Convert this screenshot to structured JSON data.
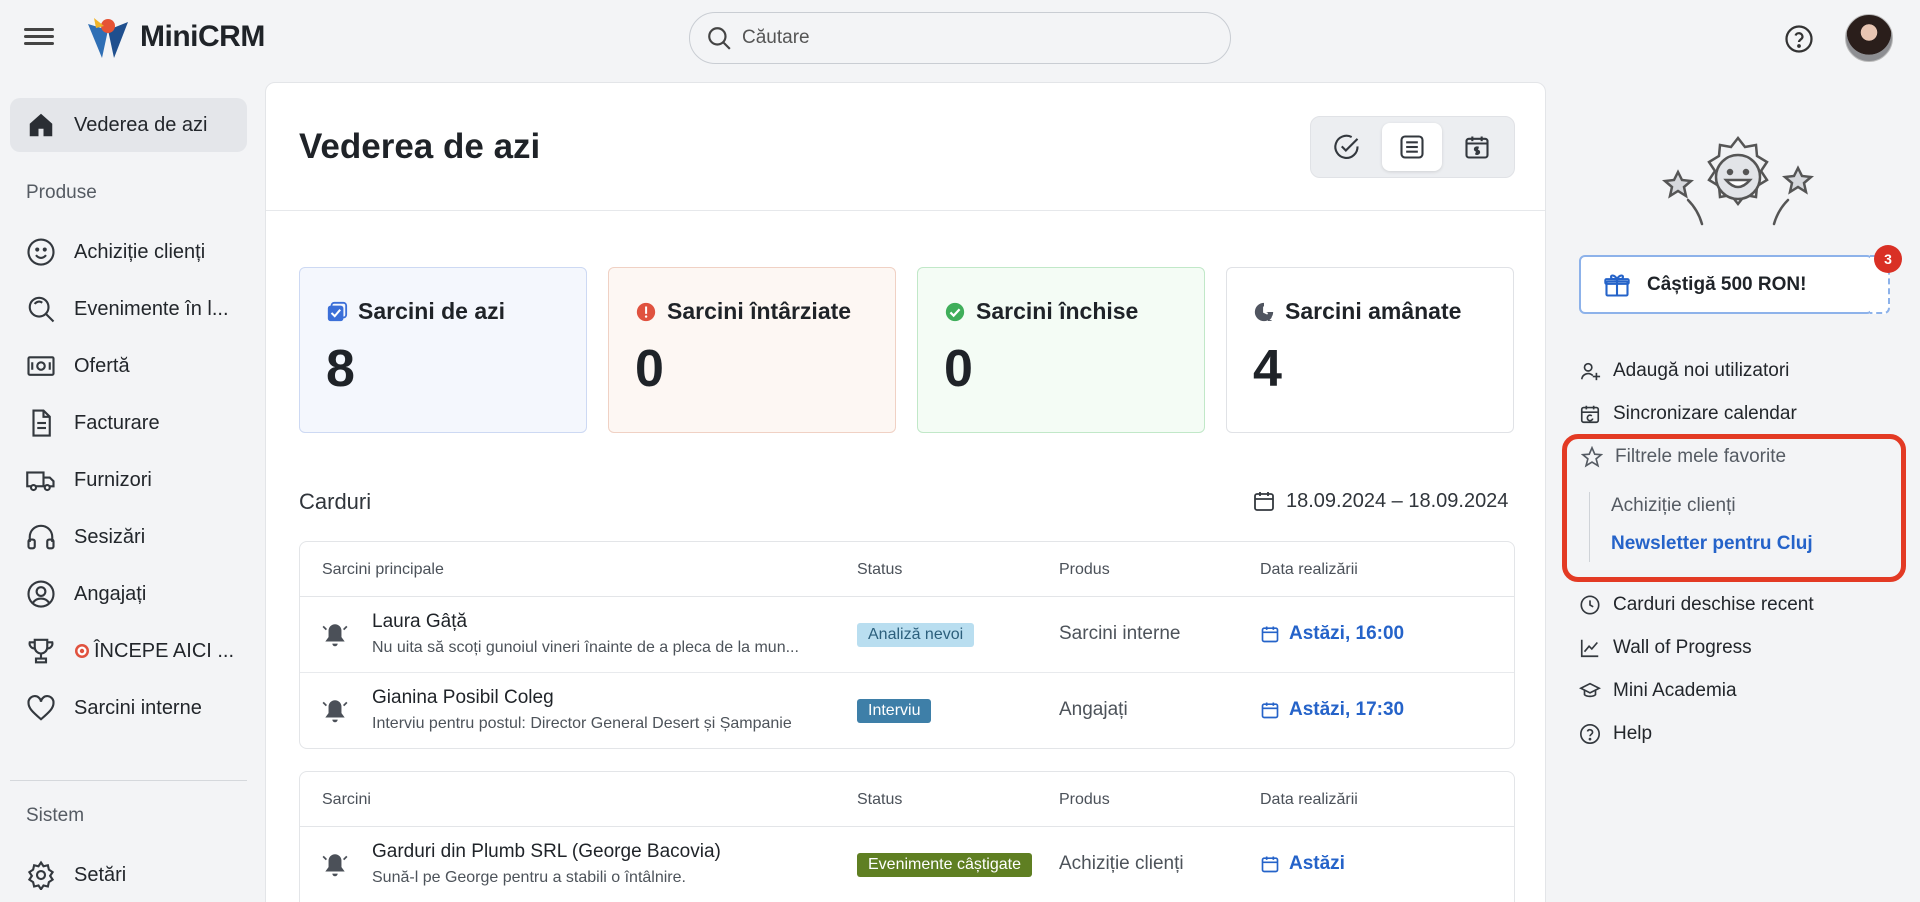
{
  "app": {
    "name": "MiniCRM"
  },
  "search": {
    "placeholder": "Căutare"
  },
  "sidebar": {
    "active": "Vederea de azi",
    "section_products": "Produse",
    "items": [
      "Achiziție clienți",
      "Evenimente în l...",
      "Ofertă",
      "Facturare",
      "Furnizori",
      "Sesizări",
      "Angajați",
      "ÎNCEPE AICI ...",
      "Sarcini interne"
    ],
    "section_system": "Sistem",
    "settings": "Setări"
  },
  "page": {
    "title": "Vederea de azi"
  },
  "stats": [
    {
      "label": "Sarcini de azi",
      "value": "8",
      "color": "#3b6fd8"
    },
    {
      "label": "Sarcini întârziate",
      "value": "0",
      "color": "#e0523f"
    },
    {
      "label": "Sarcini închise",
      "value": "0",
      "color": "#3fae5a"
    },
    {
      "label": "Sarcini amânate",
      "value": "4",
      "color": "#505560"
    }
  ],
  "cards_section": {
    "title": "Carduri",
    "date_range": "18.09.2024 – 18.09.2024"
  },
  "main_tasks": {
    "headers": [
      "Sarcini principale",
      "Status",
      "Produs",
      "Data realizării"
    ],
    "rows": [
      {
        "name": "Laura Gâță",
        "desc": "Nu uita să scoți gunoiul vineri înainte de a pleca de la mun...",
        "status": "Analiză nevoi",
        "product": "Sarcini interne",
        "date": "Astăzi, 16:00"
      },
      {
        "name": "Gianina Posibil Coleg",
        "desc": "Interviu pentru postul: Director General Desert și Șampanie",
        "status": "Interviu",
        "product": "Angajați",
        "date": "Astăzi, 17:30"
      }
    ]
  },
  "tasks": {
    "headers": [
      "Sarcini",
      "Status",
      "Produs",
      "Data realizării"
    ],
    "rows": [
      {
        "name": "Garduri din Plumb SRL (George Bacovia)",
        "desc": "Sună-l pe George pentru a stabili o întâlnire.",
        "status": "Evenimente câștigate",
        "product": "Achiziție clienți",
        "date": "Astăzi"
      }
    ]
  },
  "right_panel": {
    "promo": "Câștigă 500 RON!",
    "promo_badge": "3",
    "links": [
      "Adaugă noi utilizatori",
      "Sincronizare calendar"
    ],
    "favorites_title": "Filtrele mele favorite",
    "favorites": [
      "Achiziție clienți",
      "Newsletter pentru Cluj"
    ],
    "more_links": [
      "Carduri deschise recent",
      "Wall of Progress",
      "Mini Academia",
      "Help"
    ]
  },
  "colors": {
    "accent_blue": "#2563c9",
    "badge_analiza": "#b9def0",
    "badge_interviu": "#3e7fa8",
    "badge_castigate": "#5f7f22",
    "highlight_red": "#e33a24"
  }
}
